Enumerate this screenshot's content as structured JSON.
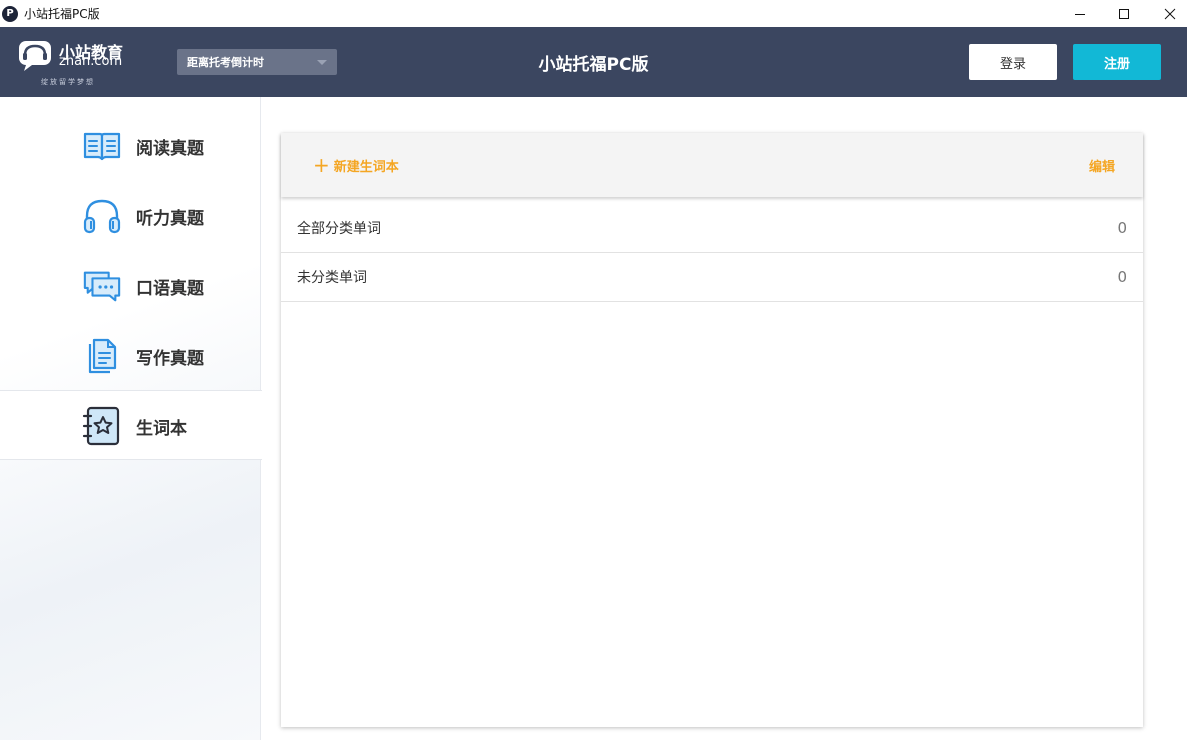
{
  "window": {
    "title": "小站托福PC版",
    "app_icon_letter": "P"
  },
  "header": {
    "logo": {
      "brand": "小站教育",
      "domain": "zhan.com",
      "slogan": "绽放留学梦想"
    },
    "countdown_label": "距离托考倒计时",
    "title": "小站托福PC版",
    "login_label": "登录",
    "register_label": "注册"
  },
  "sidebar": {
    "items": [
      {
        "label": "阅读真题",
        "icon": "book-icon",
        "active": false
      },
      {
        "label": "听力真题",
        "icon": "headphones-icon",
        "active": false
      },
      {
        "label": "口语真题",
        "icon": "chat-bubble-icon",
        "active": false
      },
      {
        "label": "写作真题",
        "icon": "document-icon",
        "active": false
      },
      {
        "label": "生词本",
        "icon": "notebook-star-icon",
        "active": true
      }
    ]
  },
  "main": {
    "toolbar": {
      "new_label": "新建生词本",
      "edit_label": "编辑"
    },
    "rows": [
      {
        "label": "全部分类单词",
        "count": "0"
      },
      {
        "label": "未分类单词",
        "count": "0"
      }
    ]
  },
  "colors": {
    "header_bg": "#3b4660",
    "accent_orange": "#f4a623",
    "register_bg": "#12b8d6",
    "icon_blue": "#2f8fe0"
  }
}
